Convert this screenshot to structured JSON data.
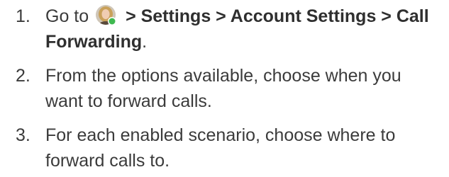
{
  "steps": [
    {
      "number": "1.",
      "prefix": "Go to",
      "path": "> Settings > Account Settings > Call Forwarding",
      "suffix": ".",
      "icon": "user-avatar-icon",
      "status_color": "#3fb950"
    },
    {
      "number": "2.",
      "text": "From the options available, choose when you want to forward calls."
    },
    {
      "number": "3.",
      "text": "For each enabled scenario, choose where to forward calls to."
    }
  ],
  "colors": {
    "text": "#3b3b3b",
    "presence": "#3fb950"
  }
}
